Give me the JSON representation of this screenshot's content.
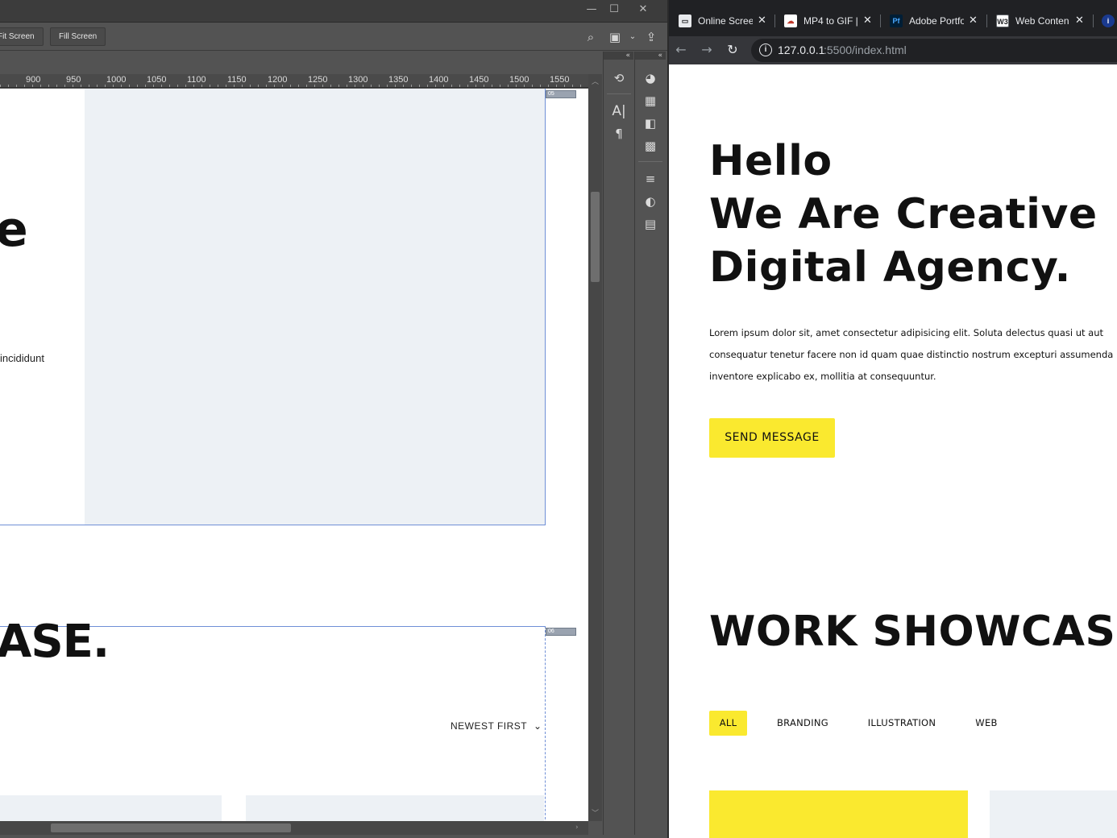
{
  "app": {
    "window_controls": {
      "minimize": "—",
      "maximize": "☐",
      "close": "✕"
    },
    "toolbar": {
      "fit_screen_label": "Fit Screen",
      "fill_screen_label": "Fill Screen",
      "icons": [
        "search-icon",
        "screen-mode-icon",
        "chevron-down-icon",
        "share-icon"
      ]
    },
    "ruler": {
      "labels": [
        "900",
        "950",
        "1000",
        "1050",
        "1100",
        "1150",
        "1200",
        "1250",
        "1300",
        "1350",
        "1400",
        "1450",
        "1500",
        "1550"
      ]
    },
    "canvas": {
      "big_letter": "e",
      "body_fragment": "incididunt",
      "heading_fragment": "ASE.",
      "sort_label": "NEWEST FIRST",
      "frame_badge_1": "05",
      "frame_badge_2": "06"
    },
    "panels": {
      "collapse_glyph": "«",
      "col1_icons": [
        "history-icon",
        "character-icon",
        "paragraph-icon"
      ],
      "col2_icons": [
        "color-palette-icon",
        "swatches-icon",
        "gradient-icon",
        "patterns-icon",
        "adjustments-icon",
        "styles-icon",
        "libraries-icon"
      ]
    }
  },
  "browser": {
    "tabs": [
      {
        "title": "Online Scree",
        "favicon": "monitor-icon"
      },
      {
        "title": "MP4 to GIF |",
        "favicon": "cloud-icon"
      },
      {
        "title": "Adobe Portfo",
        "favicon": "pf-icon",
        "favicon_text": "Pf"
      },
      {
        "title": "Web Conten",
        "favicon": "w3-icon",
        "favicon_text": "W3"
      }
    ],
    "url_host": "127.0.0.1",
    "url_path": ":5500/index.html"
  },
  "page": {
    "hero": {
      "line1": "Hello",
      "line2": "We Are Creative",
      "line3": "Digital Agency."
    },
    "paragraph": [
      "Lorem ipsum dolor sit, amet consectetur adipisicing elit. Soluta delectus quasi ut aut",
      "consequatur tenetur facere non id quam quae distinctio nostrum excepturi assumenda",
      "inventore explicabo ex, mollitia at consequuntur."
    ],
    "send_button": "SEND MESSAGE",
    "showcase_title": "WORK SHOWCAS",
    "filters": [
      "ALL",
      "BRANDING",
      "ILLUSTRATION",
      "WEB"
    ],
    "accent_color": "#fae92f",
    "card_placeholder_color": "#edf1f5"
  }
}
